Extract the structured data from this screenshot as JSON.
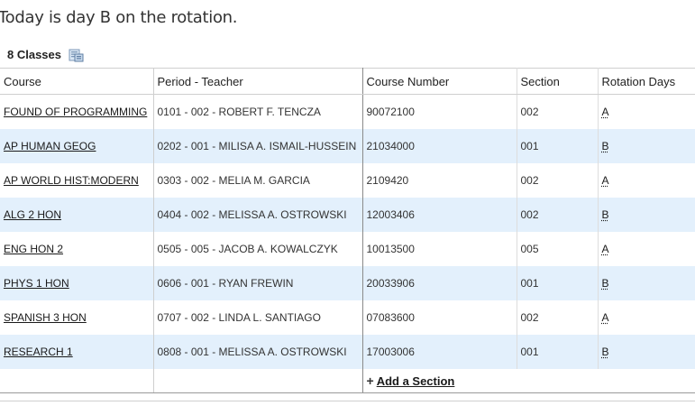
{
  "heading": "Today is day B on the rotation.",
  "class_count": "8 Classes",
  "icons": {
    "print": "printer-icon"
  },
  "columns": [
    "Course",
    "Period - Teacher",
    "Course Number",
    "Section",
    "Rotation Days"
  ],
  "rows": [
    {
      "course": "FOUND OF PROGRAMMING",
      "period_teacher": "0101 - 002 - ROBERT F. TENCZA",
      "course_number": "90072100",
      "section": "002",
      "rotation": "A"
    },
    {
      "course": "AP HUMAN GEOG",
      "period_teacher": "0202 - 001 - MILISA A. ISMAIL-HUSSEIN",
      "course_number": "21034000",
      "section": "001",
      "rotation": "B"
    },
    {
      "course": "AP WORLD HIST:MODERN",
      "period_teacher": "0303 - 002 - MELIA M. GARCIA",
      "course_number": "2109420",
      "section": "002",
      "rotation": "A"
    },
    {
      "course": "ALG 2 HON",
      "period_teacher": "0404 - 002 - MELISSA A. OSTROWSKI",
      "course_number": "12003406",
      "section": "002",
      "rotation": "B"
    },
    {
      "course": "ENG HON 2",
      "period_teacher": "0505 - 005 - JACOB A. KOWALCZYK",
      "course_number": "10013500",
      "section": "005",
      "rotation": "A"
    },
    {
      "course": "PHYS 1 HON",
      "period_teacher": "0606 - 001 - RYAN FREWIN",
      "course_number": "20033906",
      "section": "001",
      "rotation": "B"
    },
    {
      "course": "SPANISH 3 HON",
      "period_teacher": "0707 - 002 - LINDA L. SANTIAGO",
      "course_number": "07083600",
      "section": "002",
      "rotation": "A"
    },
    {
      "course": "RESEARCH 1",
      "period_teacher": "0808 - 001 - MELISSA A. OSTROWSKI",
      "course_number": "17003006",
      "section": "001",
      "rotation": "B"
    }
  ],
  "add_section": {
    "plus": "+",
    "label": "Add a Section"
  },
  "colors": {
    "alt_row": "#e3f0fc",
    "header_bg": "#ffffff",
    "text": "#222222"
  }
}
